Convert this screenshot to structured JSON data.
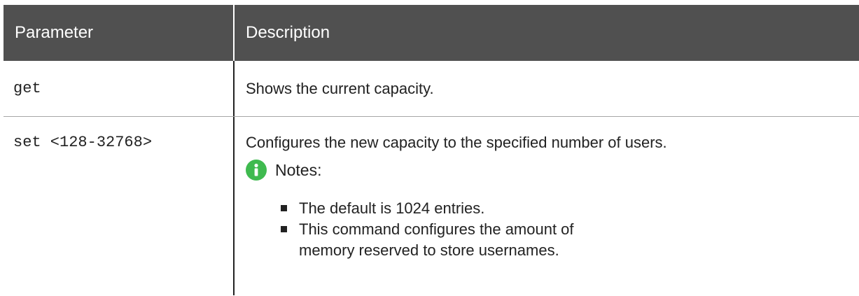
{
  "table": {
    "header": {
      "col1": "Parameter",
      "col2": "Description"
    },
    "rows": [
      {
        "param": "get",
        "description": "Shows the current capacity."
      },
      {
        "param": "set <128-32768>",
        "description": "Configures the new capacity to the specified number of users.",
        "notes_label": "Notes:",
        "notes": [
          "The default is 1024 entries.",
          "This command configures the amount of memory reserved to store usernames."
        ]
      }
    ]
  },
  "colors": {
    "header_bg": "#505050",
    "header_text": "#ffffff",
    "info_icon": "#3fba4f"
  },
  "icons": {
    "notes_icon": "info-icon"
  }
}
